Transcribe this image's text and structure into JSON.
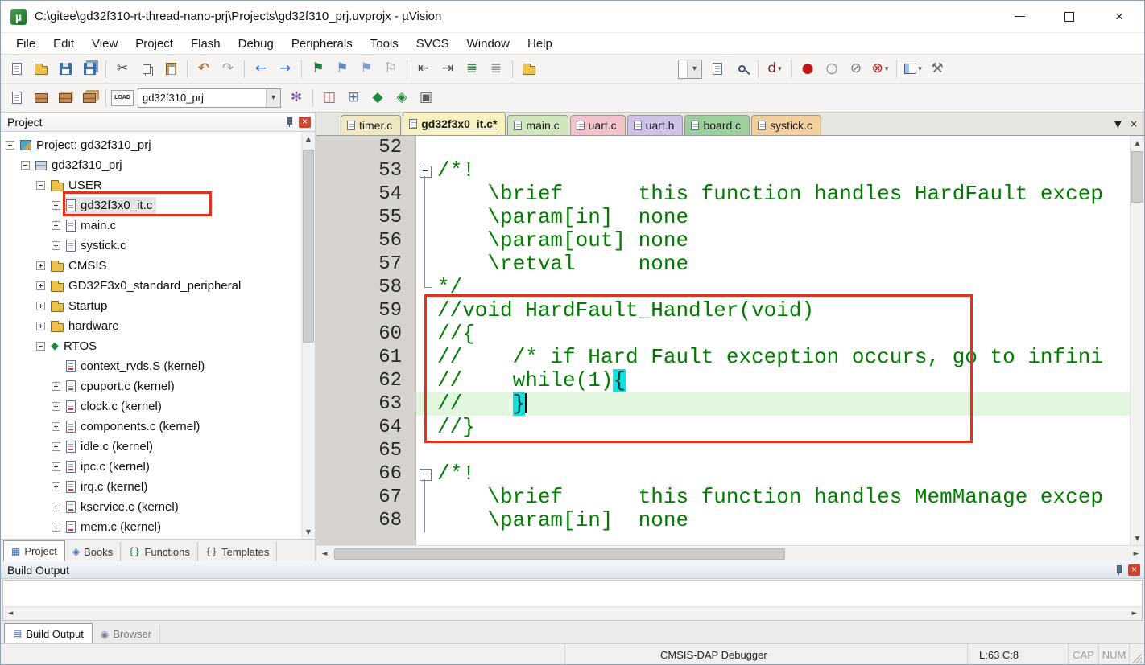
{
  "window": {
    "title": "C:\\gitee\\gd32f310-rt-thread-nano-prj\\Projects\\gd32f310_prj.uvprojx - µVision"
  },
  "icons": {
    "app_logo": "µ",
    "close": "×",
    "dropdown": "▾",
    "diamond": "◆",
    "scroll_up": "▲",
    "scroll_down": "▼",
    "scroll_left": "◄",
    "scroll_right": "►",
    "tab_list": "▼"
  },
  "colors": {
    "comment_text": "#007d00",
    "current_line_bg": "#e3f6e0",
    "brace_highlight_bg": "#16dede",
    "annotation_red": "#e5301a"
  },
  "menu": [
    "File",
    "Edit",
    "View",
    "Project",
    "Flash",
    "Debug",
    "Peripherals",
    "Tools",
    "SVCS",
    "Window",
    "Help"
  ],
  "toolbar_main": {
    "items": [
      {
        "name": "new-file",
        "cls": "ic-file"
      },
      {
        "name": "open-file",
        "cls": "ic-folder"
      },
      {
        "name": "save",
        "cls": "ic-floppy"
      },
      {
        "name": "save-all",
        "cls": "ic-floppy all"
      },
      {
        "sep": true
      },
      {
        "name": "cut",
        "glyph": "✂",
        "color": "#4a4a4a"
      },
      {
        "name": "copy",
        "cls": "ic-copy"
      },
      {
        "name": "paste",
        "cls": "ic-paste"
      },
      {
        "sep": true
      },
      {
        "name": "undo",
        "glyph": "↶",
        "color": "#b84a00"
      },
      {
        "name": "redo",
        "glyph": "↷",
        "color": "#9a9a9a"
      },
      {
        "sep": true
      },
      {
        "name": "navigate-back",
        "glyph": "←",
        "color": "#2563c4"
      },
      {
        "name": "navigate-forward",
        "glyph": "→",
        "color": "#2563c4"
      },
      {
        "sep": true
      },
      {
        "name": "toggle-bookmark",
        "glyph": "⚑",
        "color": "#1f7a3f"
      },
      {
        "name": "previous-bookmark",
        "glyph": "⚑",
        "color": "#5a8abf"
      },
      {
        "name": "next-bookmark",
        "glyph": "⚑",
        "color": "#7aa0cf"
      },
      {
        "name": "clear-all-bookmarks",
        "glyph": "⚐",
        "color": "#8a8a8a"
      },
      {
        "sep": true
      },
      {
        "name": "unindent",
        "glyph": "⇤",
        "color": "#444444"
      },
      {
        "name": "indent",
        "glyph": "⇥",
        "color": "#444444"
      },
      {
        "name": "comment-selection",
        "glyph": "≣",
        "color": "#1f7a3f"
      },
      {
        "name": "uncomment-selection",
        "glyph": "≣",
        "color": "#8a8a8a"
      },
      {
        "sep": true
      },
      {
        "name": "insert-template",
        "cls": "ic-folder"
      },
      {
        "combo": true,
        "name": "find-combobox",
        "value": "",
        "width": 30,
        "gap": true
      },
      {
        "name": "find-in-files",
        "cls": "ic-file"
      },
      {
        "name": "incremental-find",
        "cls": "ic-mag"
      },
      {
        "sep": true
      },
      {
        "name": "browse-symbol",
        "glyph": "d",
        "color": "#8a1a1a",
        "dropdown": true
      },
      {
        "sep": true
      },
      {
        "name": "insert-remove-breakpoint",
        "glyph": "●",
        "color": "#c01818"
      },
      {
        "name": "enable-disable-breakpoint",
        "glyph": "○",
        "color": "#777777"
      },
      {
        "name": "disable-all-breakpoints",
        "glyph": "⊘",
        "color": "#777777"
      },
      {
        "name": "kill-all-breakpoints",
        "glyph": "⊗",
        "color": "#c01818",
        "dropdown": true
      },
      {
        "sep": true
      },
      {
        "name": "window-layout",
        "cls": "ic-grid",
        "dropdown": true
      },
      {
        "name": "configure",
        "glyph": "⚒",
        "color": "#6a6a6a"
      }
    ]
  },
  "toolbar_build": {
    "items": [
      {
        "name": "translate-file",
        "cls": "ic-file"
      },
      {
        "name": "build-target",
        "cls": "ic-bricks"
      },
      {
        "name": "rebuild-all",
        "cls": "ic-bricks b2"
      },
      {
        "name": "batch-build",
        "cls": "ic-bricks b3"
      },
      {
        "sep": true
      },
      {
        "name": "download",
        "cls": "ic-load",
        "text": "LOAD"
      },
      {
        "combo": true,
        "name": "target-combobox",
        "value": "gd32f310_prj",
        "width": 178
      },
      {
        "name": "options-for-target",
        "glyph": "✻",
        "color": "#7a5a9a"
      },
      {
        "sep": true
      },
      {
        "name": "manage-components",
        "glyph": "◫",
        "color": "#b05050"
      },
      {
        "name": "manage-project-items",
        "glyph": "⊞",
        "color": "#4a6a9a"
      },
      {
        "name": "manage-run-time-environment",
        "glyph": "◆",
        "color": "#1f8a3f"
      },
      {
        "name": "select-software-packs",
        "glyph": "◈",
        "color": "#1f8a3f"
      },
      {
        "name": "pack-installer",
        "glyph": "▣",
        "color": "#5a5a5a"
      }
    ]
  },
  "project_panel": {
    "title": "Project",
    "tree": [
      {
        "label": "Project: gd32f310_prj",
        "level": 0,
        "expander": "minus",
        "icon": "project"
      },
      {
        "label": "gd32f310_prj",
        "level": 1,
        "expander": "minus",
        "icon": "target"
      },
      {
        "label": "USER",
        "level": 2,
        "expander": "minus",
        "icon": "folder"
      },
      {
        "label": "gd32f3x0_it.c",
        "level": 3,
        "expander": "plus",
        "icon": "file",
        "selected": true
      },
      {
        "label": "main.c",
        "level": 3,
        "expander": "plus",
        "icon": "file"
      },
      {
        "label": "systick.c",
        "level": 3,
        "expander": "plus",
        "icon": "file"
      },
      {
        "label": "CMSIS",
        "level": 2,
        "expander": "plus",
        "icon": "folder"
      },
      {
        "label": "GD32F3x0_standard_peripheral",
        "level": 2,
        "expander": "plus",
        "icon": "folder"
      },
      {
        "label": "Startup",
        "level": 2,
        "expander": "plus",
        "icon": "folder"
      },
      {
        "label": "hardware",
        "level": 2,
        "expander": "plus",
        "icon": "folder"
      },
      {
        "label": "RTOS",
        "level": 2,
        "expander": "minus",
        "icon": "rtos"
      },
      {
        "label": "context_rvds.S (kernel)",
        "level": 3,
        "expander": "none",
        "icon": "file-k"
      },
      {
        "label": "cpuport.c (kernel)",
        "level": 3,
        "expander": "plus",
        "icon": "file-k"
      },
      {
        "label": "clock.c (kernel)",
        "level": 3,
        "expander": "plus",
        "icon": "file-k"
      },
      {
        "label": "components.c (kernel)",
        "level": 3,
        "expander": "plus",
        "icon": "file-k"
      },
      {
        "label": "idle.c (kernel)",
        "level": 3,
        "expander": "plus",
        "icon": "file-k"
      },
      {
        "label": "ipc.c (kernel)",
        "level": 3,
        "expander": "plus",
        "icon": "file-k"
      },
      {
        "label": "irq.c (kernel)",
        "level": 3,
        "expander": "plus",
        "icon": "file-k"
      },
      {
        "label": "kservice.c (kernel)",
        "level": 3,
        "expander": "plus",
        "icon": "file-k"
      },
      {
        "label": "mem.c (kernel)",
        "level": 3,
        "expander": "plus",
        "icon": "file-k"
      }
    ],
    "tabs": [
      {
        "label": "Project",
        "glyph": "▦",
        "color": "#3a64b4",
        "active": true
      },
      {
        "label": "Books",
        "glyph": "◈",
        "color": "#3a64b4",
        "active": false
      },
      {
        "label": "Functions",
        "glyph": "{}",
        "color": "#1f6a4a",
        "active": false
      },
      {
        "label": "Templates",
        "glyph": "{}",
        "color": "#555555",
        "active": false
      }
    ]
  },
  "editor": {
    "tabs": [
      {
        "label": "timer.c",
        "bg": "#efe8c2",
        "active": false
      },
      {
        "label": "gd32f3x0_it.c*",
        "bg": "#f7f1c0",
        "active": true
      },
      {
        "label": "main.c",
        "bg": "#cfe6bd",
        "active": false
      },
      {
        "label": "uart.c",
        "bg": "#f3c2ca",
        "active": false
      },
      {
        "label": "uart.h",
        "bg": "#cfc1e8",
        "active": false
      },
      {
        "label": "board.c",
        "bg": "#9bcf9b",
        "active": false
      },
      {
        "label": "systick.c",
        "bg": "#f3cf9e",
        "active": false
      }
    ],
    "code": {
      "lines": [
        {
          "num": 52,
          "text": ""
        },
        {
          "num": 53,
          "text": "/*!",
          "fold": "start"
        },
        {
          "num": 54,
          "text": "    \\brief      this function handles HardFault excep",
          "fold": "mid"
        },
        {
          "num": 55,
          "text": "    \\param[in]  none",
          "fold": "mid"
        },
        {
          "num": 56,
          "text": "    \\param[out] none",
          "fold": "mid"
        },
        {
          "num": 57,
          "text": "    \\retval     none",
          "fold": "mid"
        },
        {
          "num": 58,
          "text": "*/",
          "fold": "end"
        },
        {
          "num": 59,
          "text": "//void HardFault_Handler(void)"
        },
        {
          "num": 60,
          "text": "//{"
        },
        {
          "num": 61,
          "text": "//    /* if Hard Fault exception occurs, go to infini"
        },
        {
          "num": 62,
          "text": "//    while(1){",
          "brace": 14
        },
        {
          "num": 63,
          "text": "//    }",
          "brace": 6,
          "current": true,
          "cursor": true
        },
        {
          "num": 64,
          "text": "//}"
        },
        {
          "num": 65,
          "text": ""
        },
        {
          "num": 66,
          "text": "/*!",
          "fold": "start"
        },
        {
          "num": 67,
          "text": "    \\brief      this function handles MemManage excep",
          "fold": "mid"
        },
        {
          "num": 68,
          "text": "    \\param[in]  none",
          "fold": "mid"
        }
      ]
    }
  },
  "build_output": {
    "title": "Build Output"
  },
  "dock_tabs": [
    {
      "label": "Build Output",
      "glyph": "▤",
      "color": "#3a64b4",
      "active": true
    },
    {
      "label": "Browser",
      "glyph": "◉",
      "color": "#7a7a9a",
      "active": false
    }
  ],
  "status_bar": {
    "debugger": "CMSIS-DAP Debugger",
    "caret": "L:63 C:8",
    "cap": "CAP",
    "num": "NUM"
  }
}
